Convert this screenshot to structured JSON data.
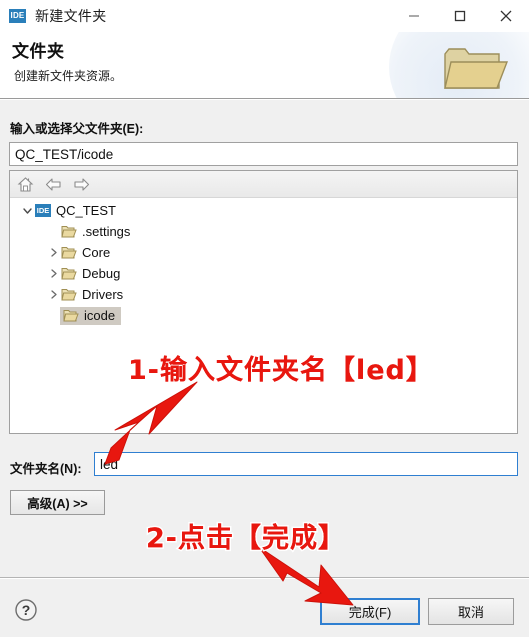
{
  "window": {
    "app_icon": "ide-icon",
    "title": "新建文件夹",
    "minimize_label": "—",
    "maximize_label": "□",
    "close_label": "✕"
  },
  "header": {
    "title": "文件夹",
    "subtitle": "创建新文件夹资源。",
    "banner_icon": "open-folder-icon"
  },
  "parent_folder": {
    "label": "输入或选择父文件夹(E):",
    "value": "QC_TEST/icode",
    "placeholder": ""
  },
  "tree": {
    "toolbar": [
      {
        "icon": "home-icon",
        "name": "home-button"
      },
      {
        "icon": "arrow-left-icon",
        "name": "back-button"
      },
      {
        "icon": "arrow-right-icon",
        "name": "forward-button"
      }
    ],
    "rows": [
      {
        "label": "QC_TEST",
        "icon": "ide-project-icon",
        "chevron": "chevron-down-icon",
        "level": 0,
        "selected": false
      },
      {
        "label": ".settings",
        "icon": "folder-icon",
        "chevron": "",
        "level": 1,
        "selected": false
      },
      {
        "label": "Core",
        "icon": "folder-icon",
        "chevron": "chevron-right-icon",
        "level": 1,
        "selected": false
      },
      {
        "label": "Debug",
        "icon": "folder-icon",
        "chevron": "chevron-right-icon",
        "level": 1,
        "selected": false
      },
      {
        "label": "Drivers",
        "icon": "folder-icon",
        "chevron": "chevron-right-icon",
        "level": 1,
        "selected": false
      },
      {
        "label": "icode",
        "icon": "folder-icon",
        "chevron": "",
        "level": 1,
        "selected": true
      }
    ]
  },
  "folder_name": {
    "label": "文件夹名(N):",
    "value": "led",
    "placeholder": ""
  },
  "advanced": {
    "label": "高级(A) >>"
  },
  "footer": {
    "help_label": "?",
    "finish_label": "完成(F)",
    "cancel_label": "取消"
  },
  "annotations": [
    {
      "text": "1-输入文件夹名【led】",
      "color": "#e8170f"
    },
    {
      "text": "2-点击【完成】",
      "color": "#e8170f"
    }
  ],
  "colors": {
    "accent": "#2f7fd1",
    "annotation_red": "#e8170f",
    "ide_badge": "#2a7fba",
    "folder": "#d8c48a",
    "selection": "#cfcac2",
    "window_bg": "#f0f0f0"
  }
}
